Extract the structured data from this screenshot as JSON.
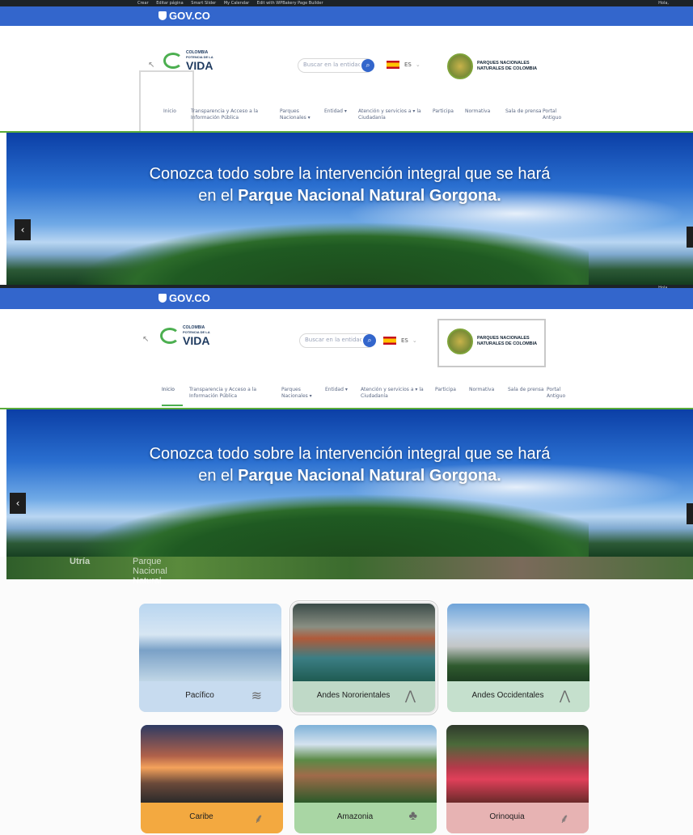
{
  "wp_admin": {
    "items": [
      "Crear",
      "Editar página",
      "Smart Slider",
      "My Calendar",
      "Edit with WPBakery Page Builder"
    ],
    "greeting": "Hola,"
  },
  "gov": {
    "logo": "GOV.CO"
  },
  "brand": {
    "small": "COLOMBIA",
    "tagline": "POTENCIA DE LA",
    "big": "VIDA"
  },
  "search": {
    "placeholder": "Buscar en la entidad"
  },
  "lang": {
    "code": "ES",
    "caret": "⌄"
  },
  "pnn": {
    "line1": "PARQUES NACIONALES",
    "line2": "NATURALES DE COLOMBIA"
  },
  "nav": [
    {
      "label": "Inicio"
    },
    {
      "label": "Transparencia y Acceso a la Información Pública"
    },
    {
      "label": "Parques Nacionales ▾"
    },
    {
      "label": "Entidad ▾"
    },
    {
      "label": "Atención y servicios a ▾ la Ciudadanía"
    },
    {
      "label": "Participa"
    },
    {
      "label": "Normativa"
    },
    {
      "label": "Sala de prensa"
    },
    {
      "label": "Portal Antiguo"
    }
  ],
  "hero": {
    "line1": "Conozca todo sobre la intervención integral que se hará",
    "line2_plain": "en el ",
    "line2_bold": "Parque Nacional Natural Gorgona.",
    "prev": "‹"
  },
  "strip": {
    "caption_plain": "Parque Nacional Natural ",
    "caption_bold": "Utría"
  },
  "regions": [
    {
      "name": "Pacífico",
      "icon": "waves-icon"
    },
    {
      "name": "Andes Nororientales",
      "icon": "mountain-icon"
    },
    {
      "name": "Andes Occidentales",
      "icon": "mountain-icon"
    },
    {
      "name": "Caribe",
      "icon": "palms-icon"
    },
    {
      "name": "Amazonia",
      "icon": "tree-icon"
    },
    {
      "name": "Orinoquia",
      "icon": "palms-icon"
    }
  ],
  "colors": {
    "gov_blue": "#3366cc",
    "accent_green": "#4caf50"
  }
}
